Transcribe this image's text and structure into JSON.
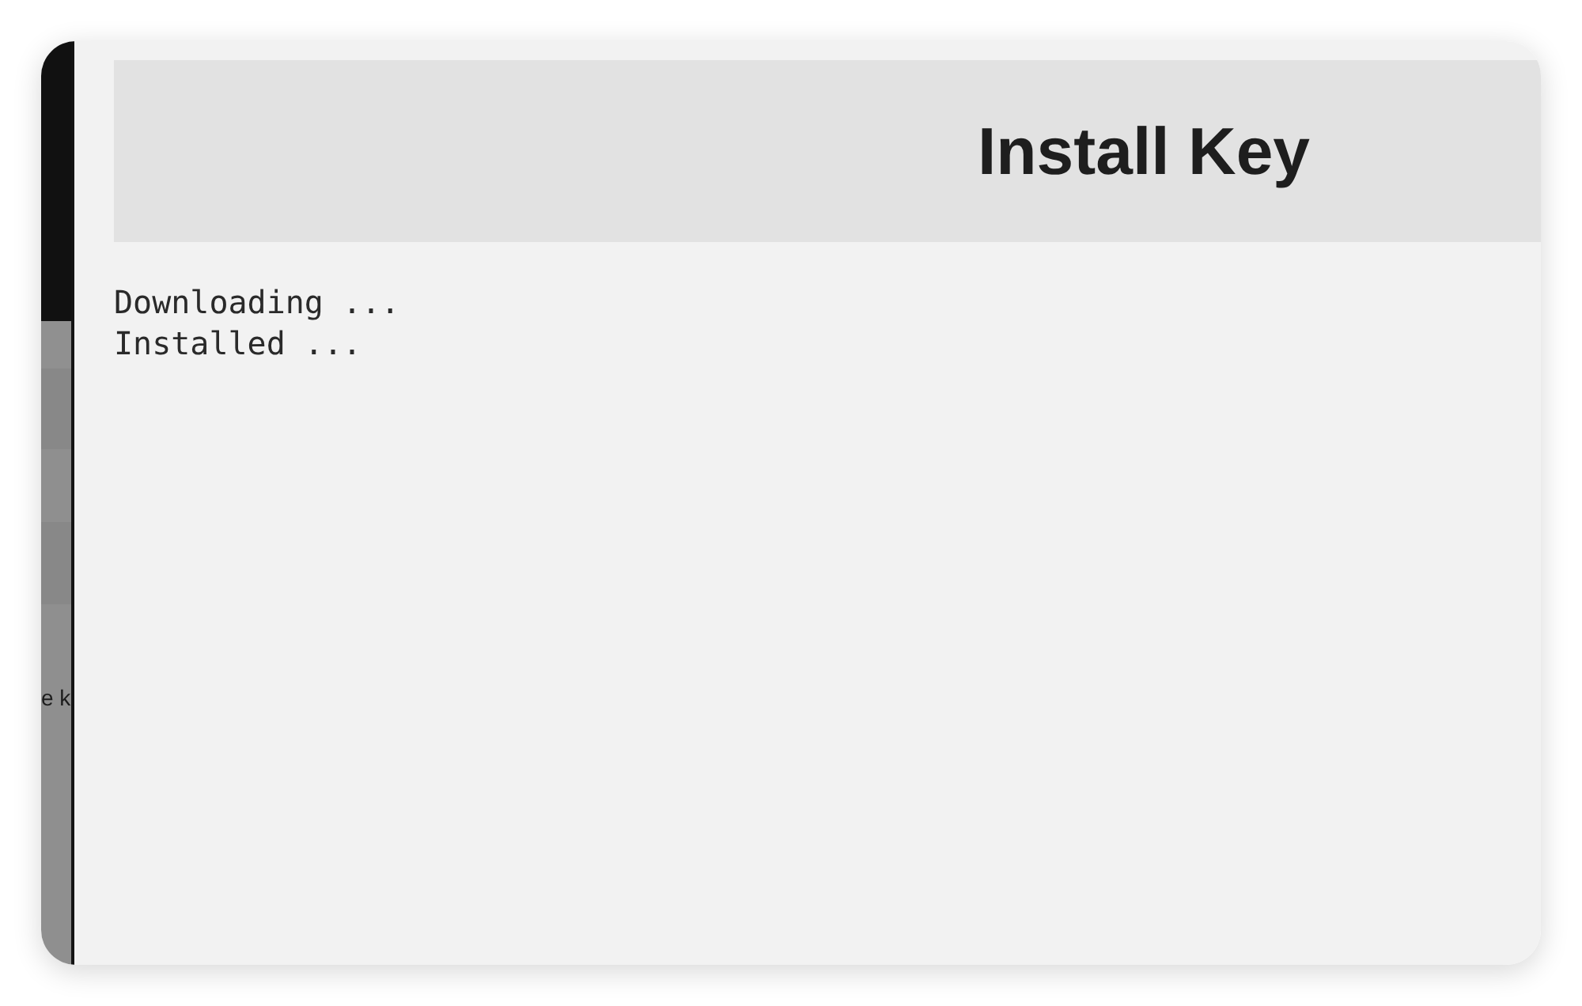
{
  "sidebar": {
    "label": "e k"
  },
  "header": {
    "title": "Install Key"
  },
  "log": {
    "lines": [
      "Downloading ...",
      "Installed ..."
    ]
  }
}
